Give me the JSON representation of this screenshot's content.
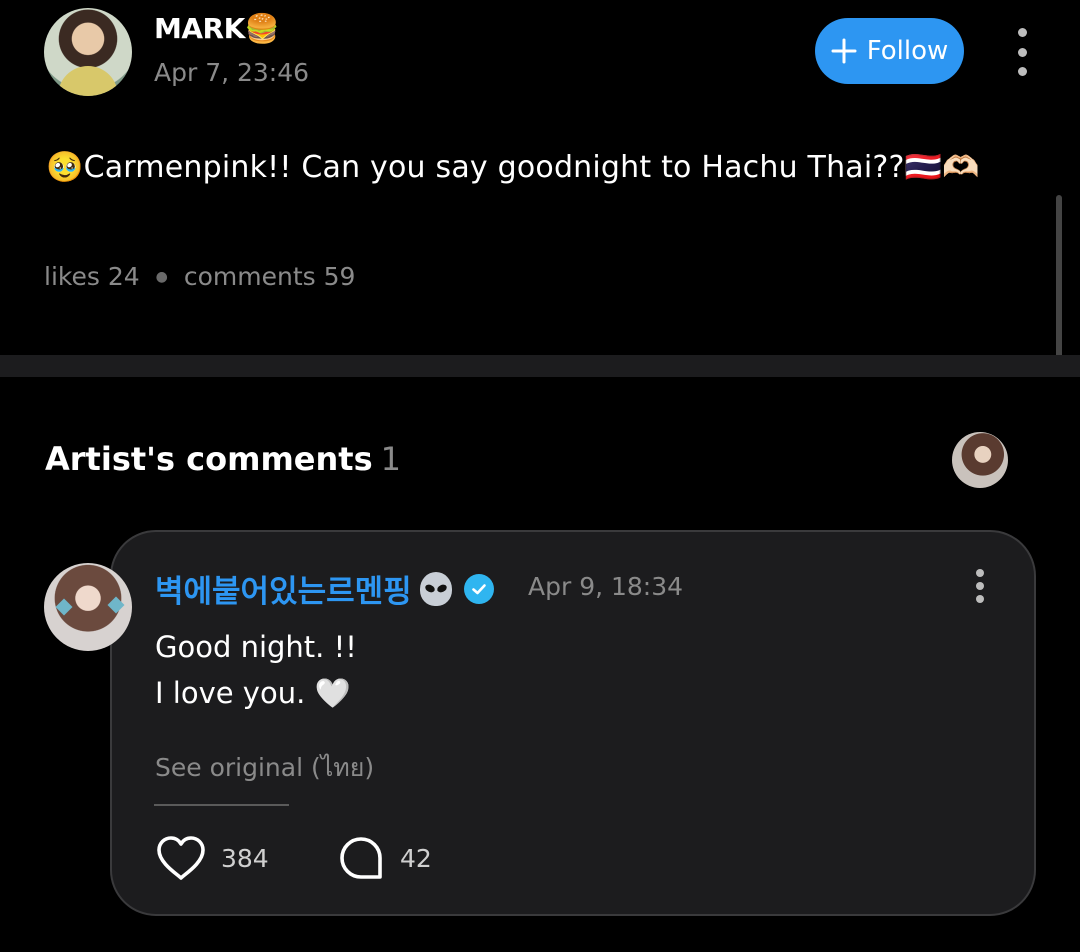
{
  "post": {
    "author": "MARK",
    "author_emoji": "🍔",
    "timestamp": "Apr 7, 23:46",
    "follow_label": "Follow",
    "body_prefix_emoji": "🥹",
    "body_text": "Carmenpink!! Can you say goodnight to Hachu Thai??",
    "body_suffix_emoji": "🇹🇭🫶🏻",
    "likes_label": "likes",
    "likes_count": "24",
    "comments_label": "comments",
    "comments_count": "59"
  },
  "artist_comments": {
    "title": "Artist's comments",
    "count": "1",
    "comment": {
      "author": "벽에붙어있는르멘핑",
      "timestamp": "Apr 9, 18:34",
      "line1": "Good night. !!",
      "line2": "I love you.",
      "line2_emoji": "🤍",
      "see_original": "See original (ไทย)",
      "like_count": "384",
      "reply_count": "42"
    }
  },
  "icons": {
    "verified_color": "#2fb5f0",
    "accent": "#2d96f2"
  }
}
